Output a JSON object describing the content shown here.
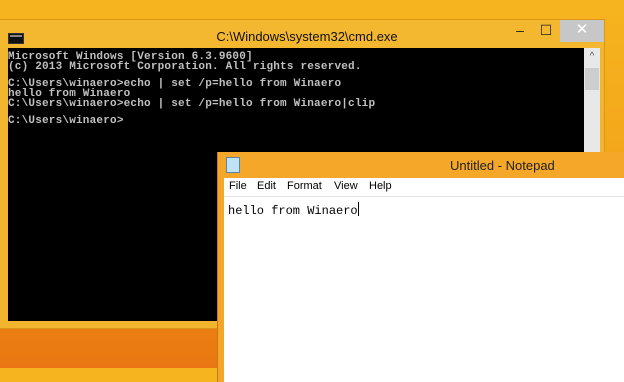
{
  "cmd": {
    "title": "C:\\Windows\\system32\\cmd.exe",
    "buttons": {
      "minimize": "–",
      "maximize": "☐",
      "close": "✕"
    },
    "lines": [
      "Microsoft Windows [Version 6.3.9600]",
      "(c) 2013 Microsoft Corporation. All rights reserved.",
      "",
      "C:\\Users\\winaero>echo | set /p=hello from Winaero",
      "hello from Winaero",
      "C:\\Users\\winaero>echo | set /p=hello from Winaero|clip",
      "",
      "C:\\Users\\winaero>"
    ],
    "scroll_up": "^"
  },
  "notepad": {
    "title": "Untitled - Notepad",
    "menu": [
      "File",
      "Edit",
      "Format",
      "View",
      "Help"
    ],
    "text": "hello from Winaero"
  }
}
